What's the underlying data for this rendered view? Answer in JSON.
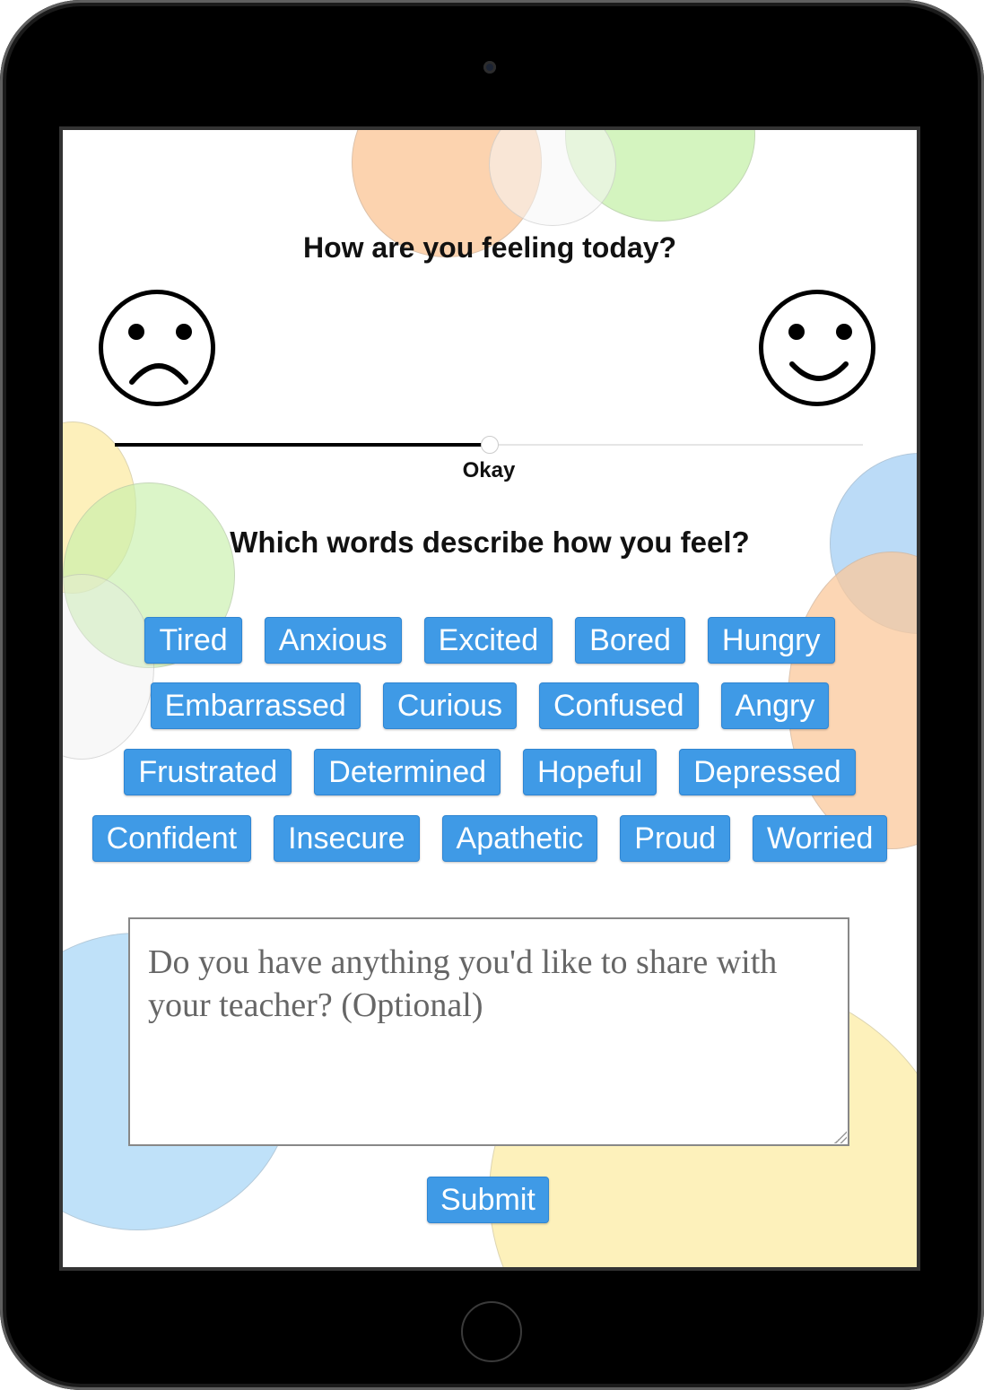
{
  "survey": {
    "mood_question": "How are you feeling today?",
    "mood_slider": {
      "value_label": "Okay",
      "value": 0.5
    },
    "words_question": "Which words describe how you feel?",
    "word_rows": [
      [
        "Tired",
        "Anxious",
        "Excited",
        "Bored",
        "Hungry"
      ],
      [
        "Embarrassed",
        "Curious",
        "Confused",
        "Angry"
      ],
      [
        "Frustrated",
        "Determined",
        "Hopeful",
        "Depressed"
      ],
      [
        "Confident",
        "Insecure",
        "Apathetic",
        "Proud",
        "Worried"
      ]
    ],
    "share_placeholder": "Do you have anything you'd like to share with your teacher? (Optional)",
    "submit_label": "Submit"
  },
  "colors": {
    "button_blue": "#3f9ae6",
    "bubble_orange": "#fbd3ae",
    "bubble_green": "#d6f5bf",
    "bubble_blue": "#bfe0f8",
    "bubble_yellow": "#fdf2b8"
  }
}
